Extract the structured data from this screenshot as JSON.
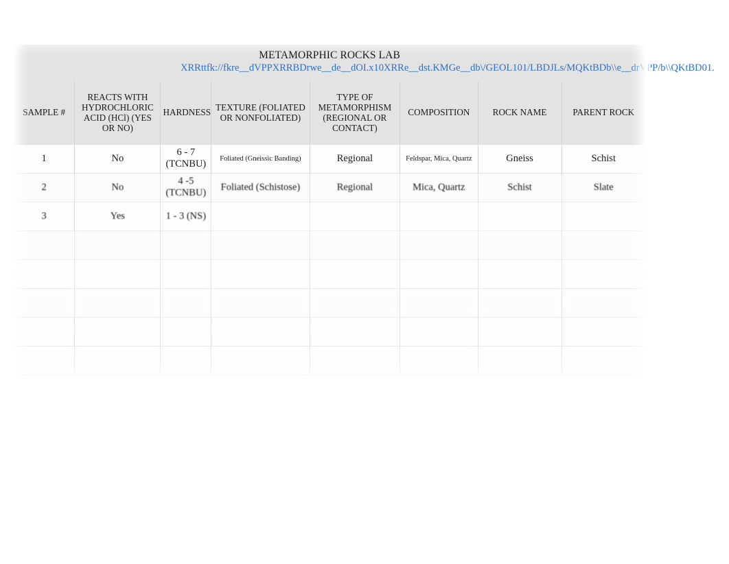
{
  "document": {
    "title": "METAMORPHIC ROCKS LAB",
    "url": "XRRttfk://fkre__dVPPXRRBDrwe__de__dOI.x10XRRe__dst.KMGe__db\\/GEOL101/LBDJLs/MQKtBDb\\\\e__drVPP/b\\\\QKtBD01.",
    "url_color": "#2e6fc4",
    "header_bg": "#e3e3e3"
  },
  "table": {
    "columns": [
      "SAMPLE #",
      "REACTS WITH HYDROCHLORIC ACID (HCl) (YES OR NO)",
      "HARDNESS",
      "TEXTURE (FOLIATED OR NONFOLIATED)",
      "TYPE OF METAMORPHISM (REGIONAL OR CONTACT)",
      "COMPOSITION",
      "ROCK NAME",
      "PARENT ROCK"
    ],
    "rows": [
      {
        "blur": 0,
        "cells": [
          "1",
          "No",
          "6 - 7 (TCNBU)",
          "Foliated (Gneissic Banding)",
          "Regional",
          "Feldspar, Mica, Quartz",
          "Gneiss",
          "Schist"
        ]
      },
      {
        "blur": 1,
        "cells": [
          "2",
          "No",
          "4 -5 (TCNBU)",
          "Foliated (Schistose)",
          "Regional",
          "Mica, Quartz",
          "Schist",
          "Slate"
        ]
      },
      {
        "blur": 2,
        "cells": [
          "3",
          "Yes",
          "1 - 3 (NS)",
          "",
          "",
          "",
          "",
          ""
        ]
      },
      {
        "blur": 3,
        "cells": [
          "",
          "",
          "",
          "",
          "",
          "",
          "",
          ""
        ]
      },
      {
        "blur": 4,
        "cells": [
          "",
          "",
          "",
          "",
          "",
          "",
          "",
          ""
        ]
      },
      {
        "blur": 5,
        "cells": [
          "",
          "",
          "",
          "",
          "",
          "",
          "",
          ""
        ]
      },
      {
        "blur": 6,
        "cells": [
          "",
          "",
          "",
          "",
          "",
          "",
          "",
          ""
        ]
      },
      {
        "blur": 7,
        "cells": [
          "",
          "",
          "",
          "",
          "",
          "",
          "",
          ""
        ]
      }
    ]
  }
}
